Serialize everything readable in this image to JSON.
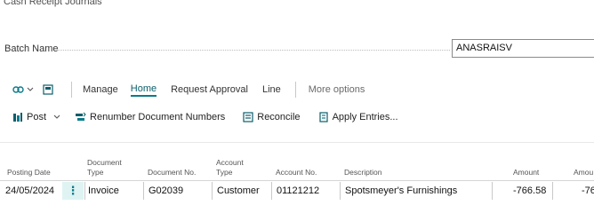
{
  "page": {
    "title": "Cash Receipt Journals"
  },
  "batch": {
    "label": "Batch Name",
    "value": "ANASRAISV"
  },
  "actionbar": {
    "items": [
      {
        "label": "Manage",
        "active": false
      },
      {
        "label": "Home",
        "active": true
      },
      {
        "label": "Request Approval",
        "active": false
      },
      {
        "label": "Line",
        "active": false
      }
    ],
    "more": "More options"
  },
  "toolbar": {
    "post": "Post",
    "renumber": "Renumber Document Numbers",
    "reconcile": "Reconcile",
    "apply_entries": "Apply Entries..."
  },
  "grid": {
    "headers": {
      "posting_date": "Posting Date",
      "document_type_1": "Document",
      "document_type_2": "Type",
      "document_no": "Document No.",
      "account_type_1": "Account",
      "account_type_2": "Type",
      "account_no": "Account No.",
      "description": "Description",
      "amount": "Amount",
      "amount_2": "Amou"
    },
    "rows": [
      {
        "posting_date": "24/05/2024",
        "document_type": "Invoice",
        "document_no": "G02039",
        "account_type": "Customer",
        "account_no": "01121212",
        "description": "Spotsmeyer's Furnishings",
        "amount": "-766.58",
        "amount_2": "-76"
      }
    ]
  },
  "colors": {
    "accent": "#0a7a8a",
    "row_highlight": "#dff3f3"
  },
  "icons": [
    "flow-icon",
    "chevron-down-icon",
    "page-icon",
    "post-icon",
    "renumber-icon",
    "reconcile-icon",
    "apply-entries-icon",
    "row-menu-icon"
  ]
}
